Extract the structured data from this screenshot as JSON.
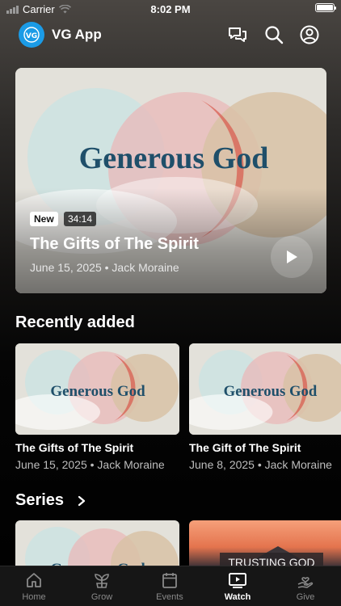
{
  "status_bar": {
    "carrier": "Carrier",
    "time": "8:02 PM"
  },
  "header": {
    "app_title": "VG App",
    "logo_text": "VG",
    "icons": [
      "chat-icon",
      "search-icon",
      "account-icon"
    ]
  },
  "hero": {
    "art_title": "Generous God",
    "badge_new": "New",
    "duration": "34:14",
    "title": "The Gifts of The Spirit",
    "meta": "June 15, 2025 • Jack Moraine"
  },
  "recently_added": {
    "heading": "Recently added",
    "items": [
      {
        "art_title": "Generous God",
        "title": "The Gifts of The Spirit",
        "meta": "June 15, 2025 • Jack Moraine"
      },
      {
        "art_title": "Generous God",
        "title": "The Gift of The Spirit",
        "meta": "June 8, 2025 • Jack Moraine"
      }
    ]
  },
  "series": {
    "heading": "Series",
    "items": [
      {
        "art_title": "Generous God"
      },
      {
        "art_title": "TRUSTING GOD"
      }
    ]
  },
  "tabs": [
    {
      "label": "Home",
      "icon": "home-icon",
      "active": false
    },
    {
      "label": "Grow",
      "icon": "sprout-icon",
      "active": false
    },
    {
      "label": "Events",
      "icon": "calendar-icon",
      "active": false
    },
    {
      "label": "Watch",
      "icon": "play-screen-icon",
      "active": true
    },
    {
      "label": "Give",
      "icon": "giving-hand-icon",
      "active": false
    }
  ],
  "colors": {
    "accent": "#1b9be6",
    "title_blue": "#1f4f6a",
    "background": "#000000"
  }
}
